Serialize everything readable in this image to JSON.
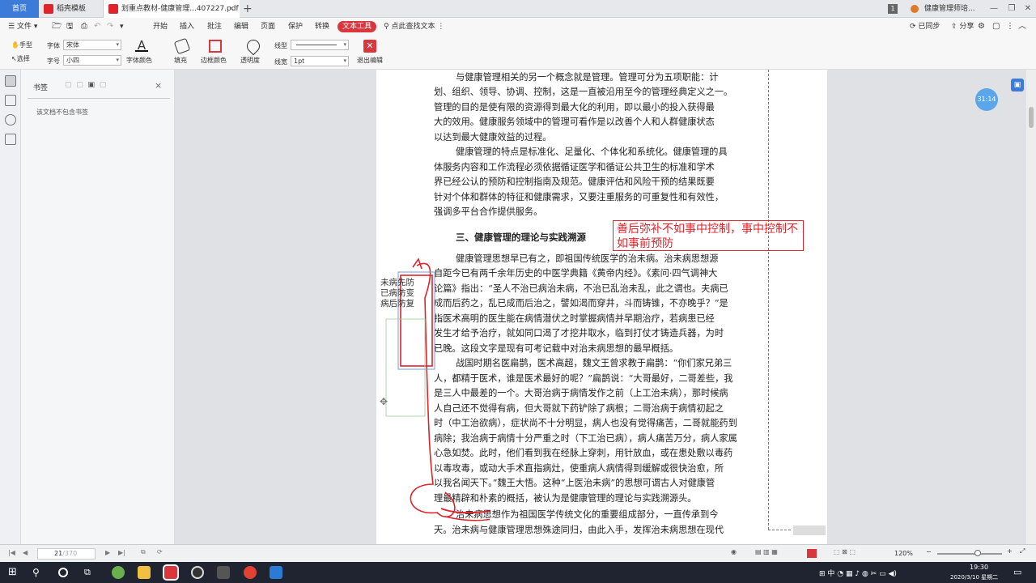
{
  "tabs": {
    "home": "首页",
    "t1": "稻壳模板",
    "t2": "划重点教材-健康管理...407227.pdf",
    "new_tab": "+",
    "page_count": "1",
    "right_title": "健康管理师培..."
  },
  "menu": {
    "file": "文件",
    "items": [
      "开始",
      "插入",
      "批注",
      "编辑",
      "页面",
      "保护",
      "转换"
    ],
    "active": "文本工具",
    "search": "点此查找文本",
    "synced": "已同步",
    "share": "分享"
  },
  "ribbon": {
    "hand": "手型",
    "select": "选择",
    "font_label": "字体",
    "font_value": "宋体",
    "size_label": "字号",
    "size_value": "小四",
    "font_color": "字体颜色",
    "fill": "填充",
    "border_color": "边框颜色",
    "opacity": "透明度",
    "line_type_label": "线型",
    "line_width_label": "线宽",
    "line_width_value": "1pt",
    "exit_edit": "退出编辑"
  },
  "sidebar": {
    "title": "书签",
    "empty": "该文档不包含书签"
  },
  "document": {
    "lines": [
      "与健康管理相关的另一个概念就是管理。管理可分为五项职能：计",
      "划、组织、领导、协调、控制，这是一直被沿用至今的管理经典定义之一。",
      "管理的目的是使有限的资源得到最大化的利用，即以最小的投入获得最",
      "大的效用。健康服务领域中的管理可看作是以改善个人和人群健康状态",
      "以达到最大健康效益的过程。",
      "健康管理的特点是标准化、足量化、个体化和系统化。健康管理的具",
      "体服务内容和工作流程必须依据循证医学和循证公共卫生的标准和学术",
      "界已经公认的预防和控制指南及规范。健康评估和风险干预的结果既要",
      "针对个体和群体的特征和健康需求，又要注重服务的可重复性和有效性，",
      "强调多平台合作提供服务。"
    ],
    "heading": "三、健康管理的理论与实践溯源",
    "lines2": [
      "健康管理思想早已有之，即祖国传统医学的治未病。治未病思想源",
      "自距今已有两千余年历史的中医学典籍《黄帝内经》。《素问·四气调神大",
      "论篇》指出：“圣人不治已病治未病，不治已乱治未乱，此之谓也。夫病已",
      "成而后药之，乱已成而后治之，譬如渴而穿井，斗而铸锥，不亦晚乎？”是",
      "指医术高明的医生能在病情潜伏之时掌握病情并早期治疗，若病患已经",
      "发生才给予治疗，就如同口渴了才挖井取水，临到打仗才铸造兵器，为时",
      "已晚。这段文字是现有可考记载中对治未病思想的最早概括。",
      "战国时期名医扁鹊，医术高超，魏文王曾求教于扁鹊：“你们家兄弟三",
      "人，都精于医术，谁是医术最好的呢？”扁鹊说：“大哥最好，二哥差些，我",
      "是三人中最差的一个。大哥治病于病情发作之前（上工治未病），那时候病",
      "人自己还不觉得有病，但大哥就下药铲除了病根；二哥治病于病情初起之",
      "时（中工治欲病），症状尚不十分明显，病人也没有觉得痛苦，二哥就能药到",
      "病除；我治病于病情十分严重之时（下工治已病），病人痛苦万分，病人家属",
      "心急如焚。此时，他们看到我在经脉上穿刺，用针放血，或在患处敷以毒药",
      "以毒攻毒，或动大手术直指病灶，使重病人病情得到缓解或很快治愈，所",
      "以我名闻天下。”魏王大悟。这种“上医治未病”的思想可谓古人对健康管",
      "理最精辟和朴素的概括，被认为是健康管理的理论与实践溯源头。",
      "治未病思想作为祖国医学传统文化的重要组成部分，一直传承到今",
      "天。治未病与健康管理思想殊途同归，由此入手，发挥治未病思想在现代"
    ],
    "note_box": "善后弥补不如事中控制，事中控制不如事前预防",
    "margin_note": [
      "未病先防",
      "已病防变",
      "病后防复"
    ],
    "timer": "31:14"
  },
  "statusbar": {
    "page_current": "21",
    "page_total": "/370",
    "zoom": "120%"
  },
  "taskbar": {
    "time": "19:30",
    "date": "2020/3/10 星期二",
    "ime": "中"
  },
  "colors": {
    "accent": "#3d7bd9",
    "annotation_red": "#e0242b",
    "active_tab_red": "#d9363e"
  }
}
